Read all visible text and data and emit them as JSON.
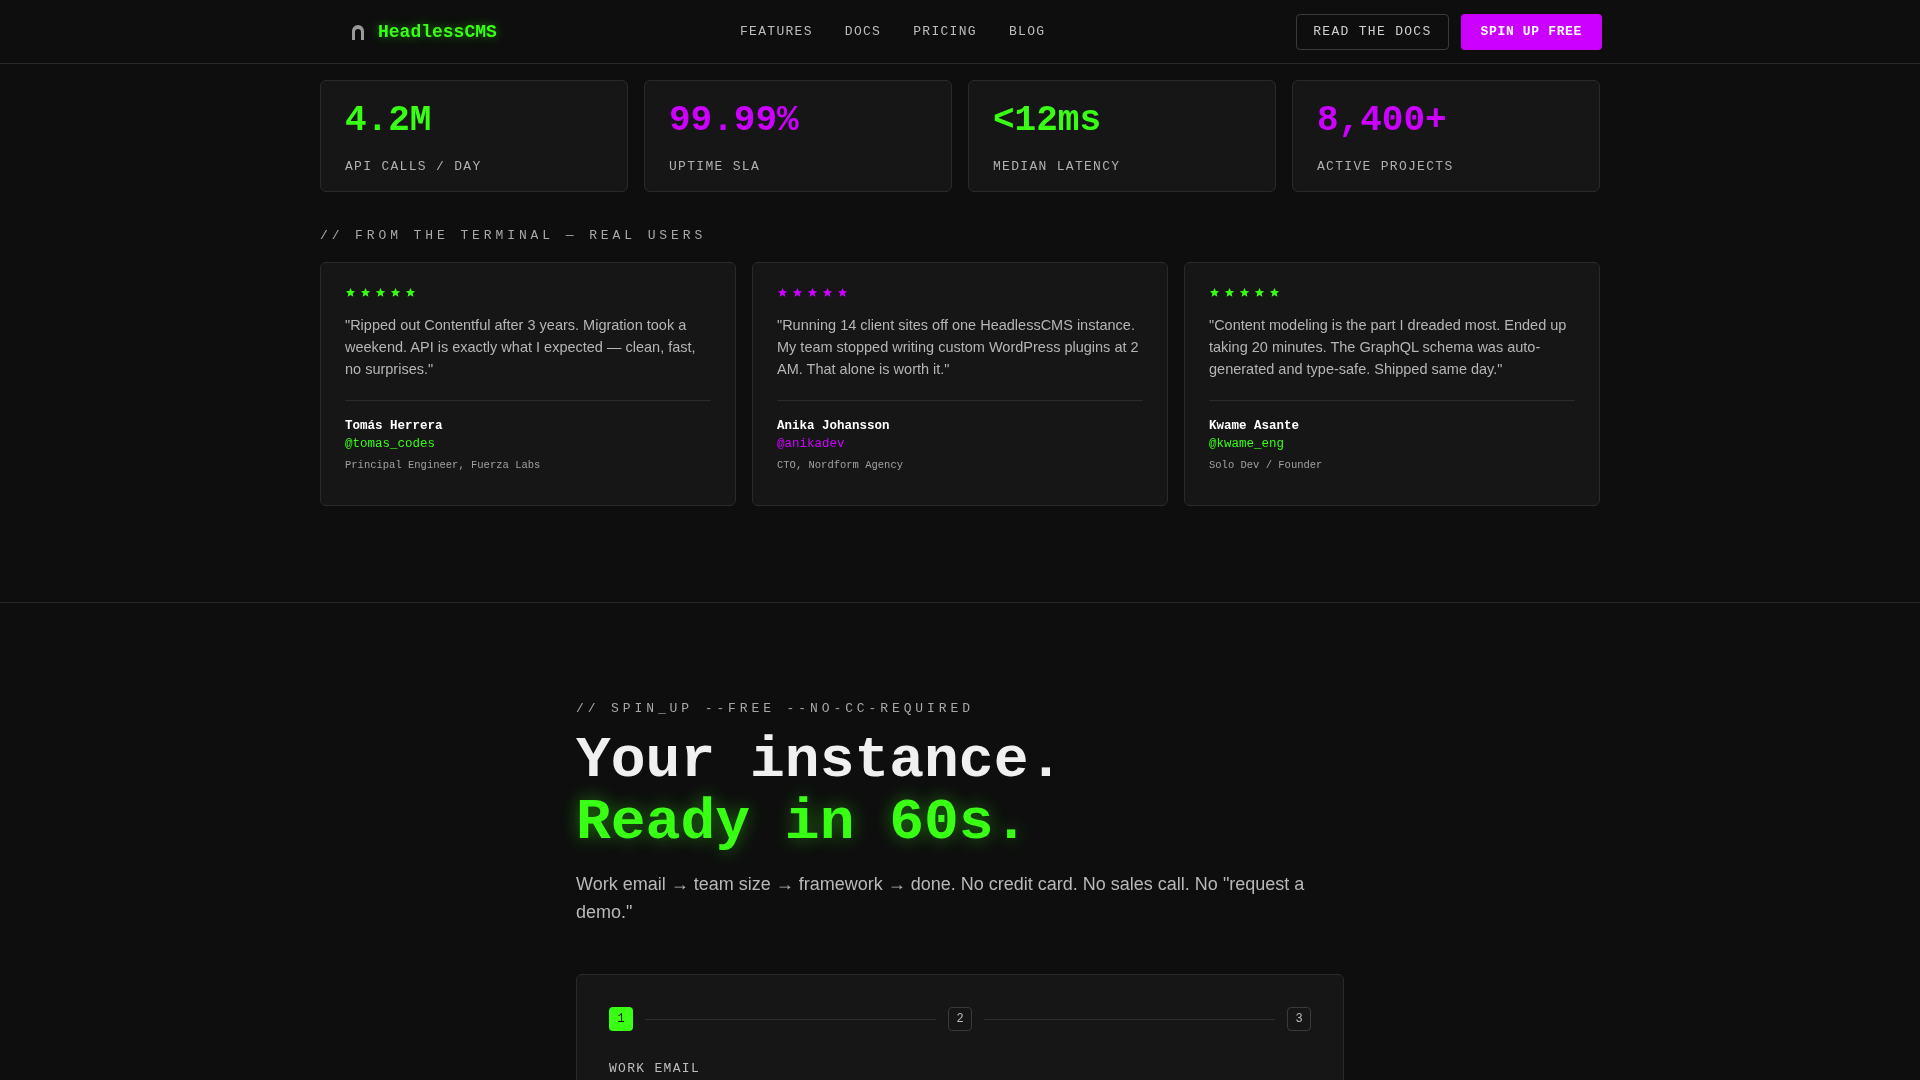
{
  "header": {
    "logo": "HeadlessCMS",
    "nav": [
      "FEATURES",
      "DOCS",
      "PRICING",
      "BLOG"
    ],
    "buttons": [
      {
        "label": "READ THE DOCS",
        "kind": "outline"
      },
      {
        "label": "SPIN UP FREE",
        "kind": "primary"
      }
    ]
  },
  "stats": [
    {
      "value": "4.2M",
      "label": "API CALLS / DAY",
      "color": "#39ff14"
    },
    {
      "value": "99.99%",
      "label": "UPTIME SLA",
      "color": "#cc00ff"
    },
    {
      "value": "<12ms",
      "label": "MEDIAN LATENCY",
      "color": "#39ff14"
    },
    {
      "value": "8,400+",
      "label": "ACTIVE PROJECTS",
      "color": "#cc00ff"
    }
  ],
  "testimonials": {
    "heading": "// FROM THE TERMINAL — REAL USERS",
    "items": [
      {
        "stars": 5,
        "color": "#39ff14",
        "quote": "\"Ripped out Contentful after 3 years. Migration took a weekend. API is exactly what I expected — clean, fast, no surprises.\"",
        "name": "Tomás Herrera",
        "handle": "@tomas_codes",
        "role": "Principal Engineer, Fuerza Labs"
      },
      {
        "stars": 5,
        "color": "#cc00ff",
        "quote": "\"Running 14 client sites off one HeadlessCMS instance. My team stopped writing custom WordPress plugins at 2 AM. That alone is worth it.\"",
        "name": "Anika Johansson",
        "handle": "@anikadev",
        "role": "CTO, Nordform Agency"
      },
      {
        "stars": 5,
        "color": "#39ff14",
        "quote": "\"Content modeling is the part I dreaded most. Ended up taking 20 minutes. The GraphQL schema was auto-generated and type-safe. Shipped same day.\"",
        "name": "Kwame Asante",
        "handle": "@kwame_eng",
        "role": "Solo Dev / Founder"
      }
    ]
  },
  "signup": {
    "eyebrow": "// SPIN_UP --FREE --NO-CC-REQUIRED",
    "title_line_1": "Your instance.",
    "title_line_2": "Ready in 60s.",
    "description": "Work email → team size → framework → done. No credit card. No sales call. No \"request a demo.\"",
    "steps": [
      {
        "label": "1",
        "selected": true
      },
      {
        "label": "2",
        "selected": false
      },
      {
        "label": "3",
        "selected": false
      }
    ],
    "field_label": "WORK EMAIL"
  }
}
